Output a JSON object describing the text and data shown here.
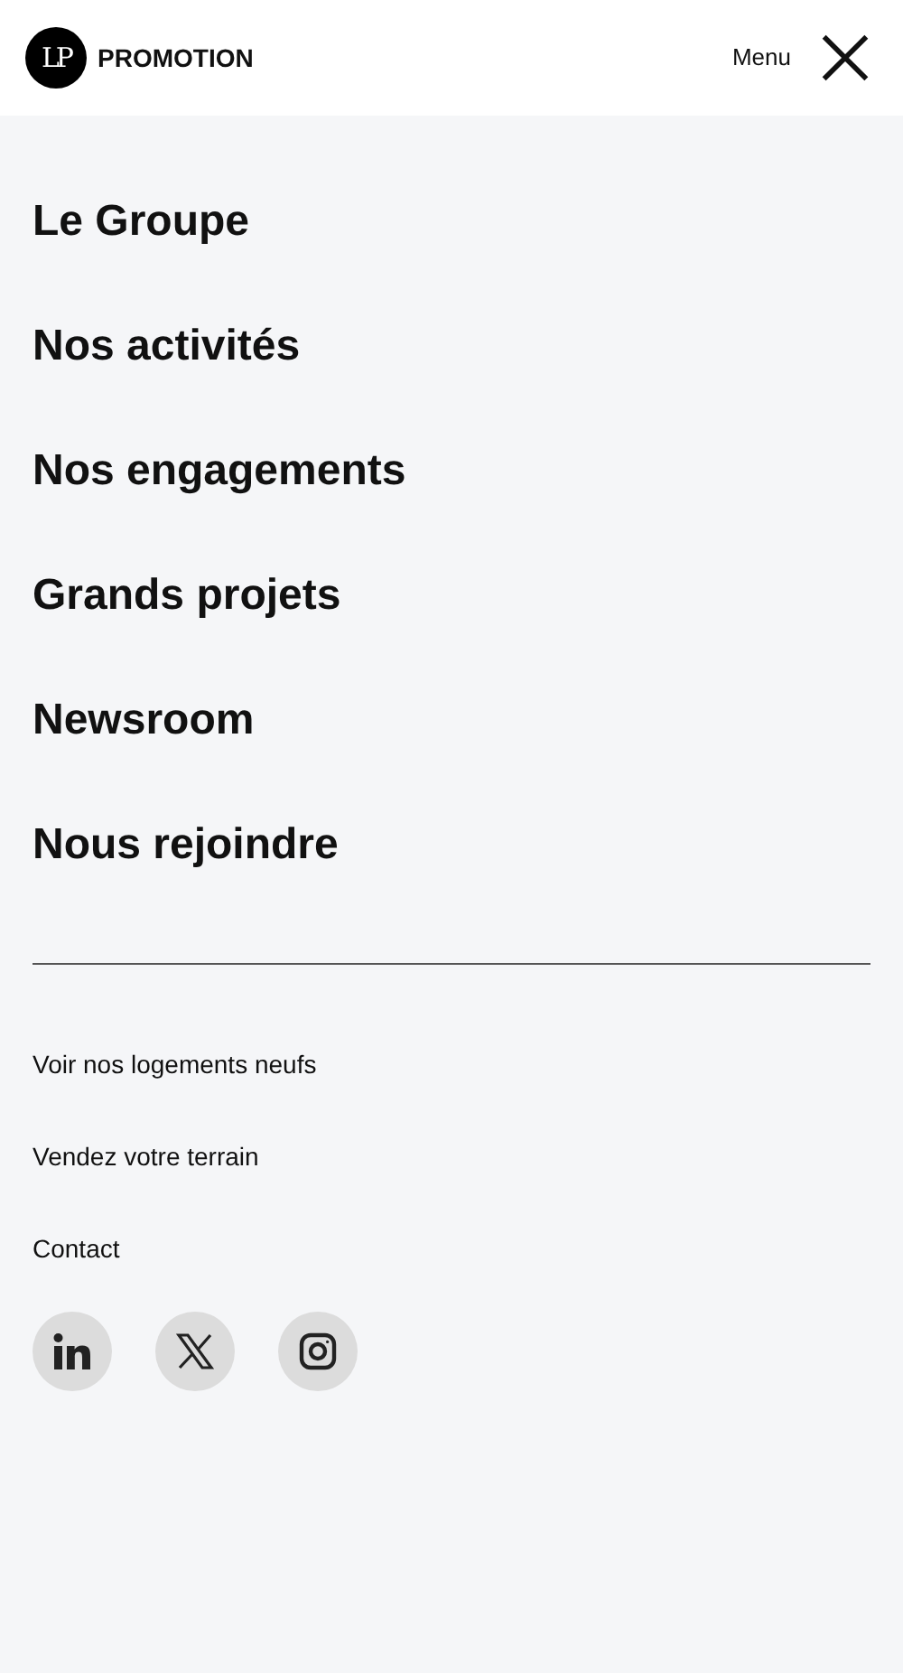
{
  "header": {
    "logo_mark": "LP",
    "brand": "PROMOTION",
    "menu_label": "Menu"
  },
  "main_nav": [
    "Le Groupe",
    "Nos activités",
    "Nos engagements",
    "Grands projets",
    "Newsroom",
    "Nous rejoindre"
  ],
  "secondary_nav": [
    "Voir nos logements neufs",
    "Vendez votre terrain",
    "Contact"
  ],
  "social": [
    {
      "kind": "linkedin"
    },
    {
      "kind": "x"
    },
    {
      "kind": "instagram"
    }
  ]
}
